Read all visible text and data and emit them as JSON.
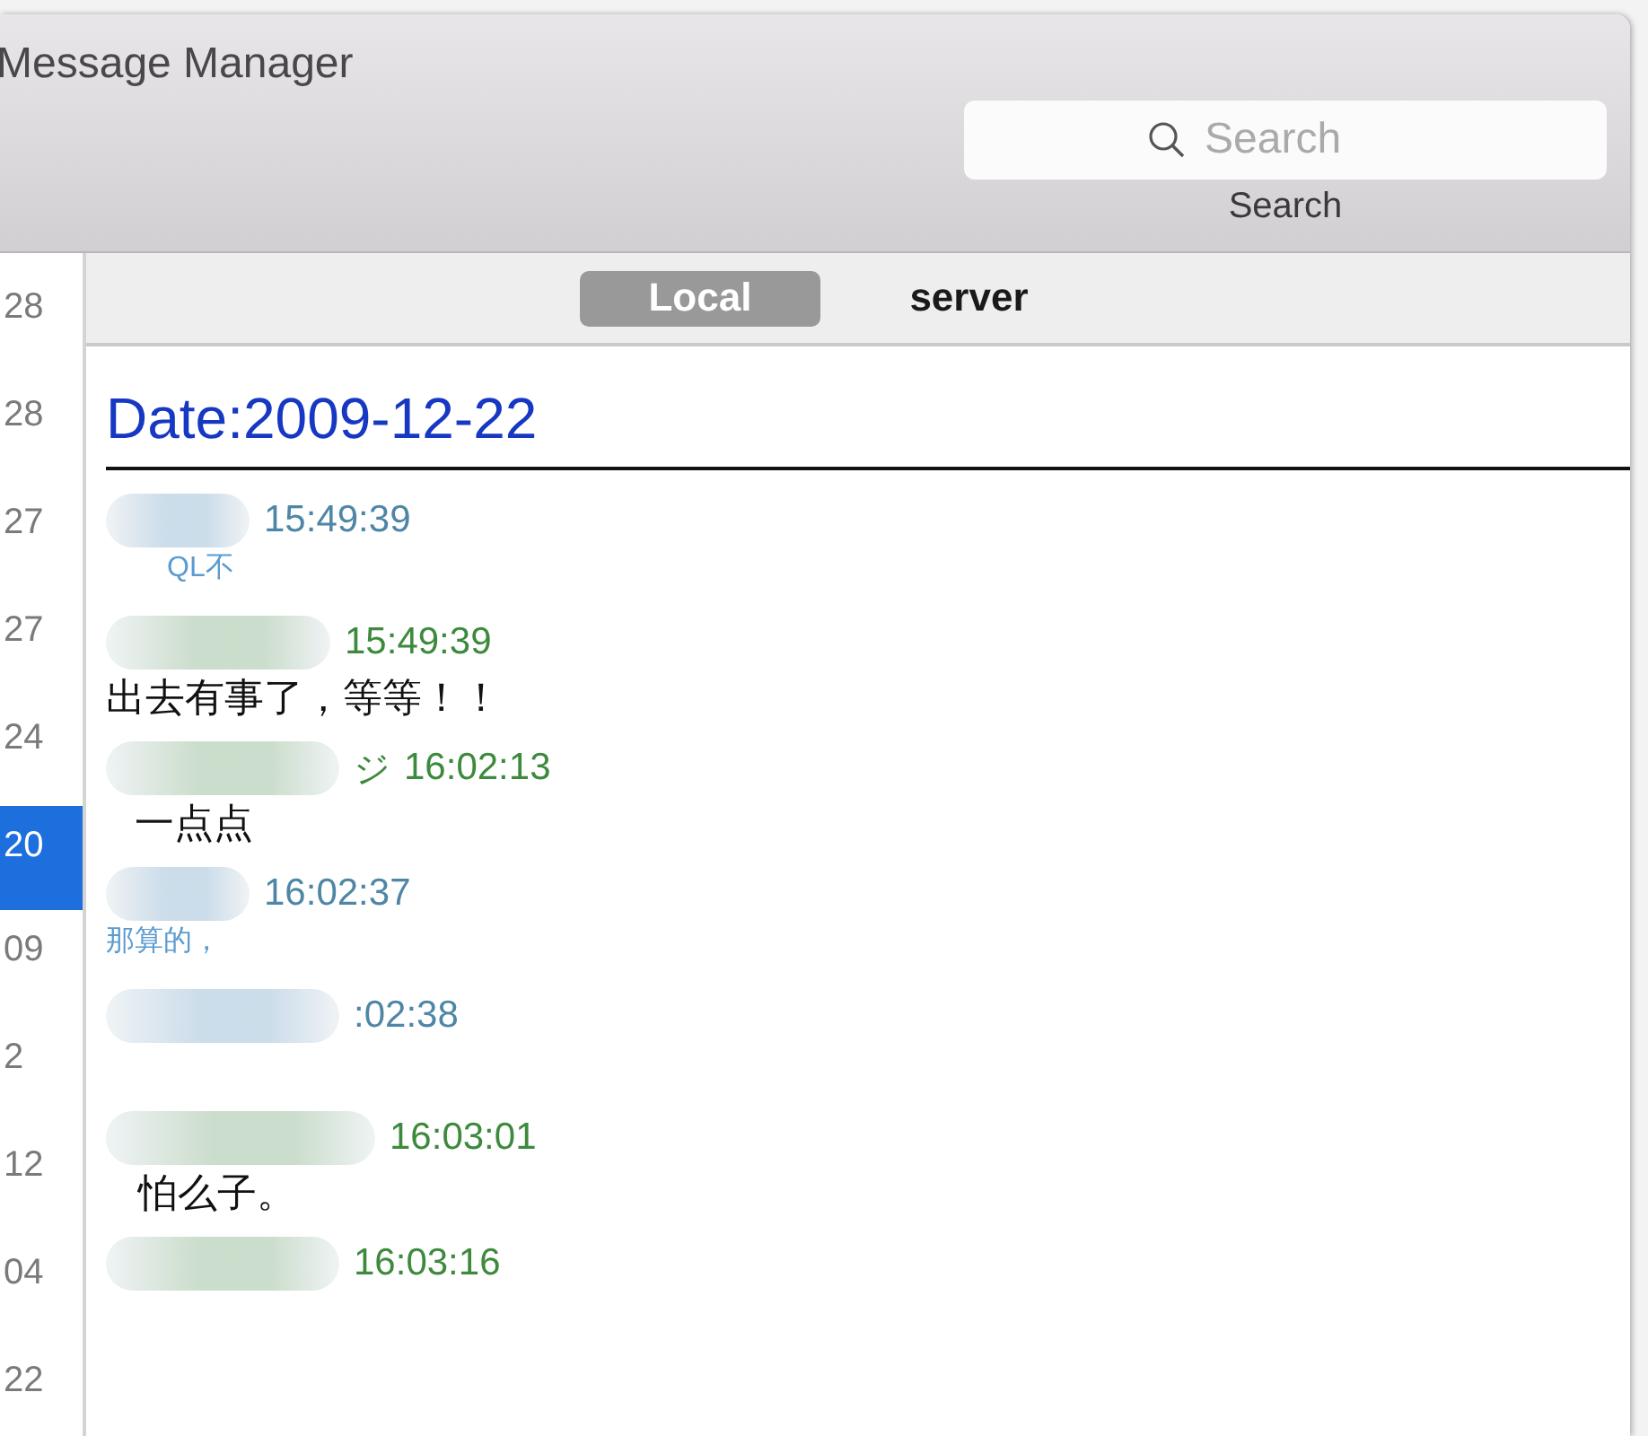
{
  "window": {
    "title": "Message Manager"
  },
  "search": {
    "placeholder": "Search",
    "label": "Search"
  },
  "tabs": [
    {
      "label": "Local",
      "selected": true
    },
    {
      "label": "server",
      "selected": false
    }
  ],
  "sidebar": {
    "items": [
      {
        "label": "28",
        "selected": false
      },
      {
        "label": "28",
        "selected": false
      },
      {
        "label": "27",
        "selected": false
      },
      {
        "label": "27",
        "selected": false
      },
      {
        "label": "24",
        "selected": false
      },
      {
        "label": "20",
        "selected": true
      },
      {
        "label": "09",
        "selected": false
      },
      {
        "label": "2",
        "selected": false
      },
      {
        "label": "12",
        "selected": false
      },
      {
        "label": "04",
        "selected": false
      },
      {
        "label": "22",
        "selected": false
      }
    ]
  },
  "conversation": {
    "date": "Date:2009-12-22",
    "messages": [
      {
        "kind": "incoming",
        "time": "15:49:39",
        "text": "QL不"
      },
      {
        "kind": "outgoing",
        "time": "15:49:39",
        "text": "出去有事了，等等！！"
      },
      {
        "kind": "outgoing",
        "sender_fragment": "ジ",
        "time": "16:02:13",
        "text": "一点点"
      },
      {
        "kind": "incoming",
        "time": "16:02:37",
        "text": "那算的，"
      },
      {
        "kind": "incoming",
        "time": ":02:38"
      },
      {
        "kind": "outgoing",
        "time": "16:03:01",
        "text": "怕么子。"
      },
      {
        "kind": "outgoing",
        "time": "16:03:16"
      }
    ]
  }
}
